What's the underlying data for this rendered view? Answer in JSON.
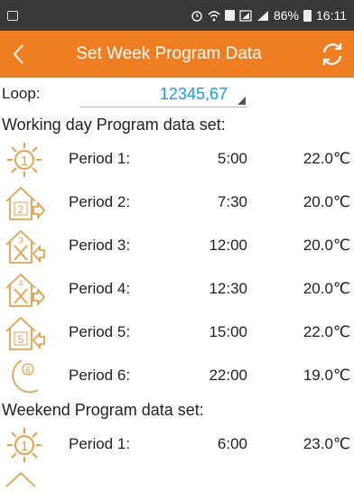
{
  "status_bar": {
    "battery_percent": "86%",
    "time": "16:11"
  },
  "header": {
    "title": "Set Week Program Data"
  },
  "loop": {
    "label": "Loop:",
    "value": "12345,67"
  },
  "working_day": {
    "title": "Working day Program data set:",
    "periods": [
      {
        "name": "Period 1:",
        "time": "5:00",
        "temp": "22.0℃",
        "icon": "sun-icon"
      },
      {
        "name": "Period 2:",
        "time": "7:30",
        "temp": "20.0℃",
        "icon": "leave-home-icon"
      },
      {
        "name": "Period 3:",
        "time": "12:00",
        "temp": "20.0℃",
        "icon": "return-home-meal-icon"
      },
      {
        "name": "Period 4:",
        "time": "12:30",
        "temp": "20.0℃",
        "icon": "leave-home-meal-icon"
      },
      {
        "name": "Period 5:",
        "time": "15:00",
        "temp": "22.0℃",
        "icon": "return-home-icon"
      },
      {
        "name": "Period 6:",
        "time": "22:00",
        "temp": "19.0℃",
        "icon": "moon-icon"
      }
    ]
  },
  "weekend": {
    "title": "Weekend Program data set:",
    "periods": [
      {
        "name": "Period 1:",
        "time": "6:00",
        "temp": "23.0℃",
        "icon": "sun-icon"
      }
    ]
  },
  "icon_numbers": [
    "1",
    "2",
    "3",
    "4",
    "5",
    "6"
  ],
  "colors": {
    "header": "#ef7d22",
    "status_bar": "#383838",
    "loop_value": "#1e9be0",
    "icon": "#e0a24f"
  }
}
